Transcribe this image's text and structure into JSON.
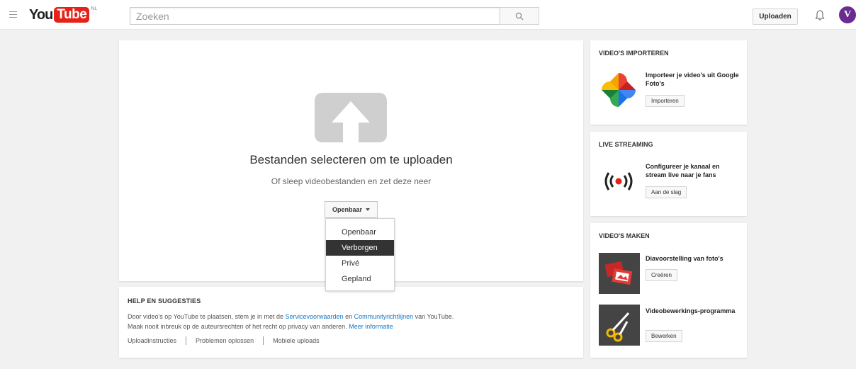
{
  "masthead": {
    "logo_you": "You",
    "logo_tube": "Tube",
    "logo_country": "NL",
    "search_placeholder": "Zoeken",
    "upload_label": "Uploaden",
    "avatar_letter": "V"
  },
  "upload": {
    "title": "Bestanden selecteren om te uploaden",
    "subtitle": "Of sleep videobestanden en zet deze neer",
    "privacy_selected": "Openbaar",
    "privacy_options": [
      "Openbaar",
      "Verborgen",
      "Privé",
      "Gepland"
    ],
    "highlighted_option": "Verborgen"
  },
  "help": {
    "title": "HELP EN SUGGESTIES",
    "line1_pre": "Door video's op YouTube te plaatsen, stem je in met de ",
    "line1_link1": "Servicevoorwaarden",
    "line1_mid": " en ",
    "line1_link2": "Communityrichtlijnen",
    "line1_post": " van YouTube.",
    "line2_pre": "Maak nooit inbreuk op de auteursrechten of het recht op privacy van anderen. ",
    "line2_link": "Meer informatie",
    "links": [
      "Uploadinstructies",
      "Problemen oplossen",
      "Mobiele uploads"
    ]
  },
  "sidebar": {
    "import": {
      "title": "VIDEO'S IMPORTEREN",
      "text": "Importeer je video's uit Google Foto's",
      "button": "Importeren"
    },
    "live": {
      "title": "LIVE STREAMING",
      "text": "Configureer je kanaal en stream live naar je fans",
      "button": "Aan de slag"
    },
    "make": {
      "title": "VIDEO'S MAKEN",
      "slideshow_text": "Diavoorstelling van foto's",
      "slideshow_button": "Creëren",
      "editor_text": "Videobewerkings-programma",
      "editor_button": "Bewerken"
    }
  },
  "colors": {
    "brand_red": "#e62117",
    "link_blue": "#167ac6",
    "avatar_purple": "#6a2c91"
  }
}
